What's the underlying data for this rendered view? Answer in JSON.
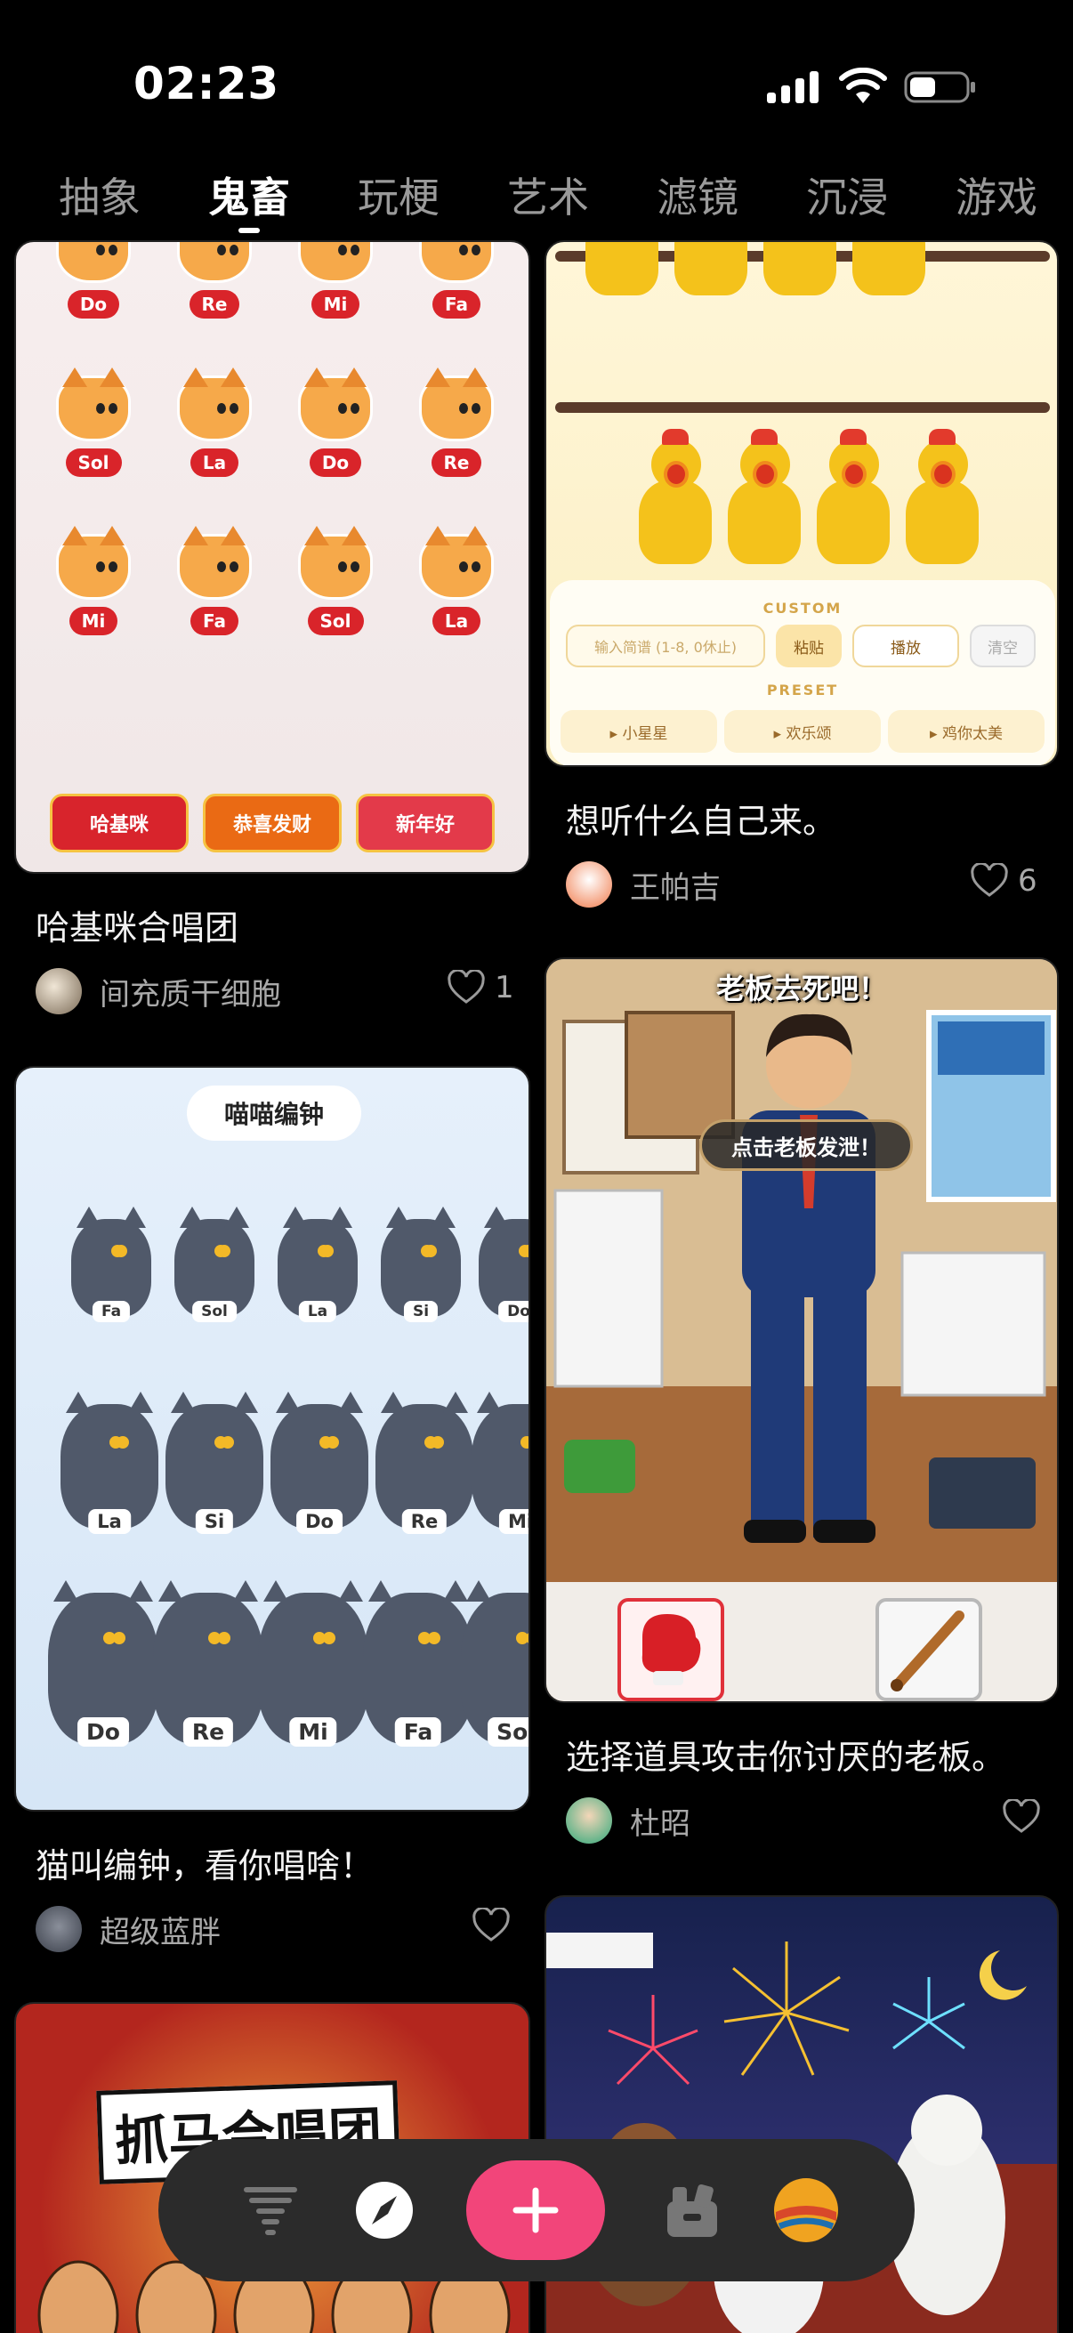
{
  "status_bar": {
    "time": "02:23"
  },
  "tabs": [
    {
      "label": "抽象"
    },
    {
      "label": "鬼畜"
    },
    {
      "label": "玩梗"
    },
    {
      "label": "艺术"
    },
    {
      "label": "滤镜"
    },
    {
      "label": "沉浸"
    },
    {
      "label": "游戏"
    }
  ],
  "active_tab": "鬼畜",
  "cards": {
    "cat_choir": {
      "title": "哈基咪合唱团",
      "author": "间充质干细胞",
      "likes": "1",
      "notes": [
        "Do",
        "Re",
        "Mi",
        "Fa",
        "Sol",
        "La",
        "Do",
        "Re",
        "Mi",
        "Fa",
        "Sol",
        "La"
      ],
      "buttons": [
        "哈基咪",
        "恭喜发财",
        "新年好"
      ]
    },
    "chickens": {
      "title": "想听什么自己来。",
      "author": "王帕吉",
      "likes": "6",
      "custom_label": "CUSTOM",
      "input_placeholder": "输入简谱 (1-8, 0休止)",
      "paste_label": "粘贴",
      "play_label": "播放",
      "clear_label": "清空",
      "preset_label": "PRESET",
      "presets": [
        "▸ 小星星",
        "▸ 欢乐颂",
        "▸ 鸡你太美"
      ]
    },
    "cat_bells": {
      "title": "猫叫编钟，看你唱啥！",
      "author": "超级蓝胖",
      "header": "喵喵编钟",
      "row1": [
        "Fa",
        "Sol",
        "La",
        "Si",
        "Do"
      ],
      "row2": [
        "La",
        "Si",
        "Do",
        "Re",
        "Mi"
      ],
      "row3": [
        "Do",
        "Re",
        "Mi",
        "Fa",
        "Sol"
      ]
    },
    "boss": {
      "title": "选择道具攻击你讨厌的老板。",
      "author": "杜昭",
      "banner": "老板去死吧！",
      "hint": "点击老板发泄！"
    },
    "horses": {
      "banner": "抓马合唱团"
    }
  },
  "colors": {
    "accent": "#f2457a",
    "note_red": "#d9242a",
    "tab_inactive": "#9a9a9a"
  },
  "bottom_nav": {
    "items": [
      "tornado-icon",
      "compass-icon",
      "add-icon",
      "tools-icon",
      "planet-icon"
    ]
  }
}
